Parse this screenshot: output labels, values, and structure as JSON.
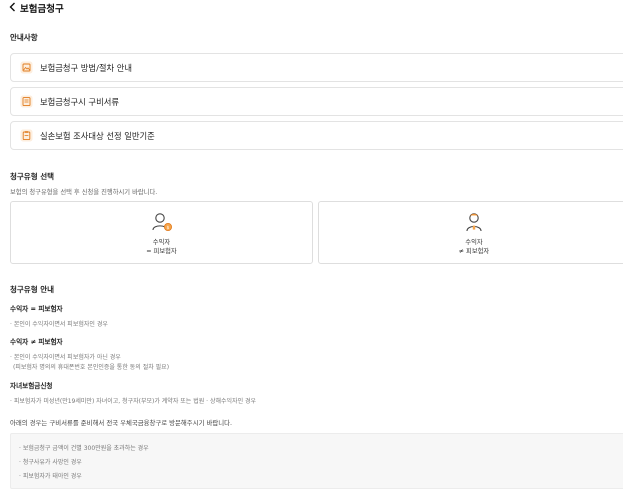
{
  "header": {
    "title": "보험금청구",
    "back_icon": "chevron-left-icon"
  },
  "guide": {
    "title": "안내사항",
    "items": [
      {
        "label": "보험금청구 방법/절차 안내",
        "icon": "document-image-icon"
      },
      {
        "label": "보험금청구시 구비서류",
        "icon": "document-list-icon"
      },
      {
        "label": "실손보험 조사대상 선정 일반기준",
        "icon": "clipboard-icon"
      }
    ]
  },
  "claim_type": {
    "title": "청구유형 선택",
    "description": "보험의 청구유형을 선택 후 신청을 진행하시기 바랍니다.",
    "options": [
      {
        "line1": "수익자",
        "line2": "= 피보험자",
        "icon": "person-coin-icon"
      },
      {
        "line1": "수익자",
        "line2": "≠ 피보험자",
        "icon": "person-doctor-icon"
      }
    ]
  },
  "type_guide": {
    "title": "청구유형 안내",
    "sections": [
      {
        "title": "수익자 = 피보험자",
        "lines": [
          "· 본인이 수익자이면서 피보험자인 경우"
        ]
      },
      {
        "title": "수익자 ≠ 피보험자",
        "lines": [
          "· 본인이 수익자이면서 피보험자가 아닌 경우",
          "(피보험자 명의의 휴대폰번호 본인인증을 통한 동의 절차 필요)"
        ]
      },
      {
        "title": "자녀보험금신청",
        "lines": [
          "· 피보험자가 미성년(만19세미만) 자녀이고, 청구자(부모)가 계약자 또는 법원 · 상해수익자인 경우"
        ]
      }
    ]
  },
  "notice": {
    "intro": "아래의 경우는 구비서류를 준비해서 전국 우체국금융창구로 방문해주시기 바랍니다.",
    "items": [
      "· 보험금청구 금액이 건별 300만원을 초과하는 경우",
      "· 청구사유가 사망인 경우",
      "· 피보험자가 태아인 경우"
    ]
  },
  "colors": {
    "accent": "#f08a24",
    "border": "#e3e3e3",
    "note_bg": "#f7f7f7"
  }
}
